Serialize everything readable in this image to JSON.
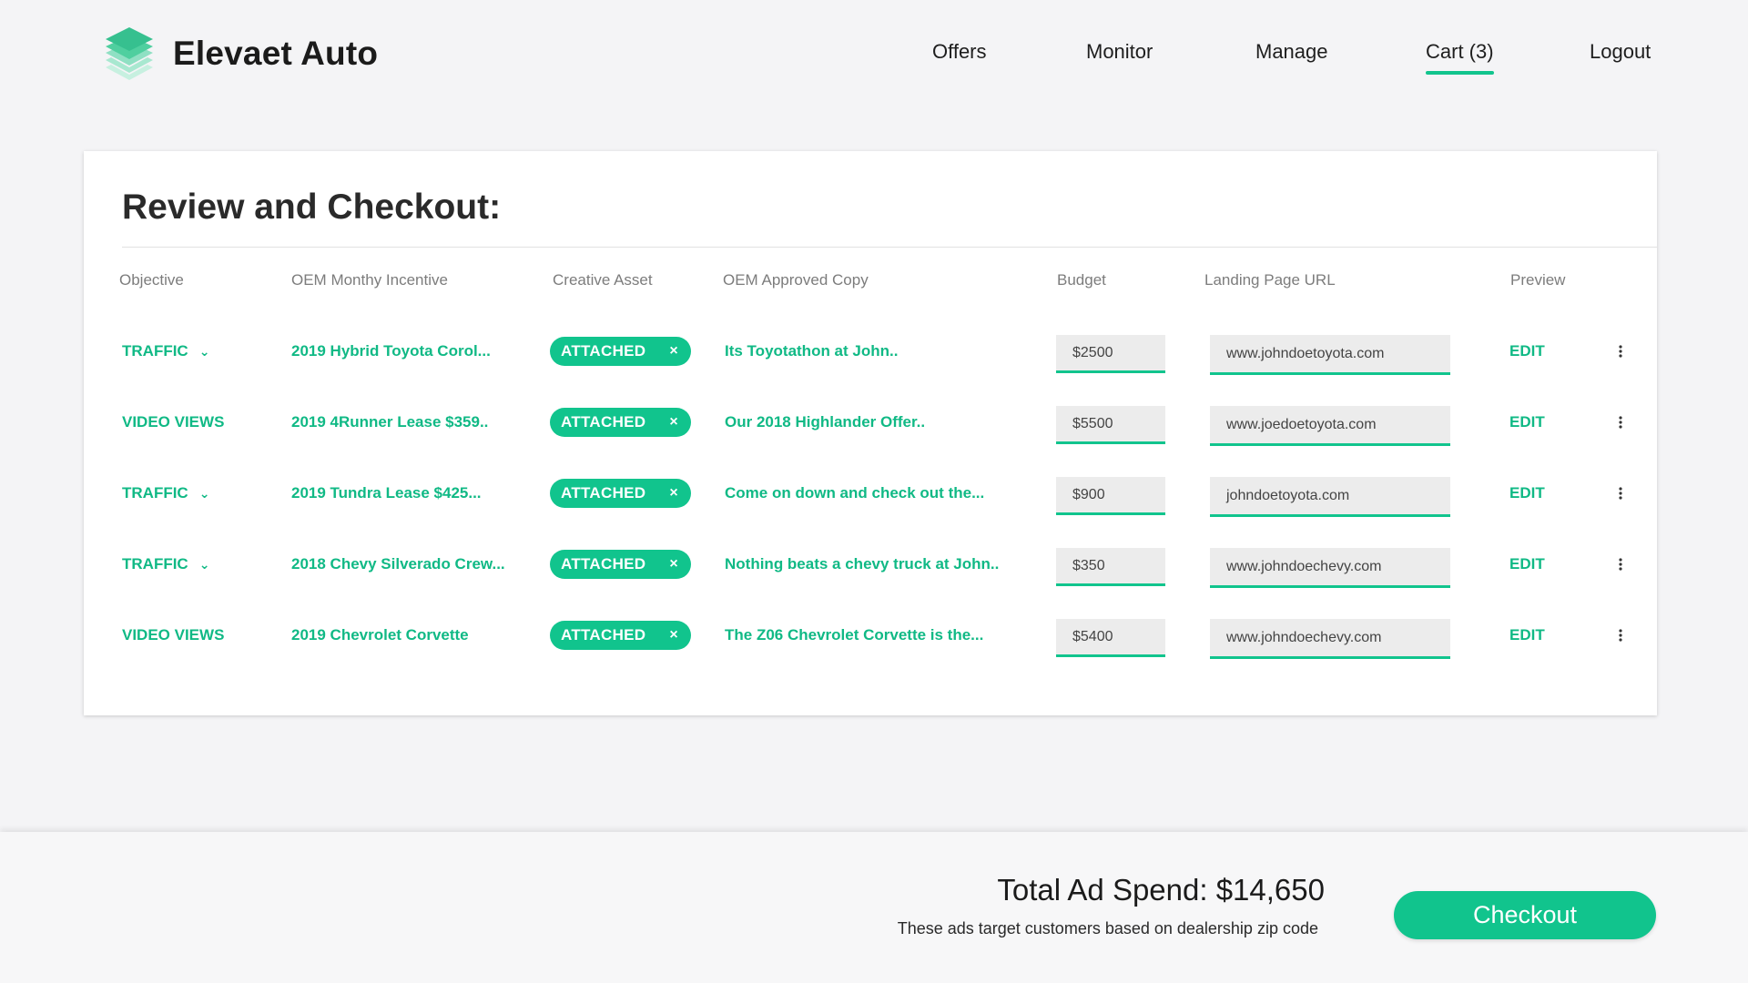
{
  "brand": {
    "name": "Elevaet Auto",
    "logo_icon": "layers-icon",
    "accent": "#11c48d"
  },
  "nav": {
    "offers": "Offers",
    "monitor": "Monitor",
    "manage": "Manage",
    "cart": "Cart (3)",
    "logout": "Logout"
  },
  "page": {
    "title": "Review and Checkout:"
  },
  "table": {
    "headers": {
      "objective": "Objective",
      "incentive": "OEM Monthy Incentive",
      "asset": "Creative Asset",
      "copy": "OEM Approved Copy",
      "budget": "Budget",
      "url": "Landing Page URL",
      "preview": "Preview"
    },
    "rows": [
      {
        "objective": "TRAFFIC",
        "incentive": "2019 Hybrid Toyota Corol...",
        "asset": "ATTACHED",
        "copy": "Its Toyotathon at John..",
        "budget": "$2500",
        "url": "www.johndoetoyota.com",
        "preview": "EDIT"
      },
      {
        "objective": "VIDEO VIEWS",
        "incentive": "2019 4Runner Lease $359..",
        "asset": "ATTACHED",
        "copy": "Our 2018 Highlander Offer..",
        "budget": "$5500",
        "url": "www.joedoetoyota.com",
        "preview": "EDIT"
      },
      {
        "objective": "TRAFFIC",
        "incentive": "2019 Tundra Lease $425...",
        "asset": "ATTACHED",
        "copy": "Come on down and check out the...",
        "budget": "$900",
        "url": "johndoetoyota.com",
        "preview": "EDIT"
      },
      {
        "objective": "TRAFFIC",
        "incentive": "2018 Chevy Silverado Crew...",
        "asset": "ATTACHED",
        "copy": "Nothing beats a chevy truck at John..",
        "budget": "$350",
        "url": "www.johndoechevy.com",
        "preview": "EDIT"
      },
      {
        "objective": "VIDEO VIEWS",
        "incentive": "2019 Chevrolet Corvette",
        "asset": "ATTACHED",
        "copy": "The Z06 Chevrolet Corvette is the...",
        "budget": "$5400",
        "url": "www.johndoechevy.com",
        "preview": "EDIT"
      }
    ],
    "remove_glyph": "×"
  },
  "footer": {
    "total": "Total Ad Spend: $14,650",
    "note": "These ads target customers based on dealership zip code",
    "checkout": "Checkout"
  }
}
